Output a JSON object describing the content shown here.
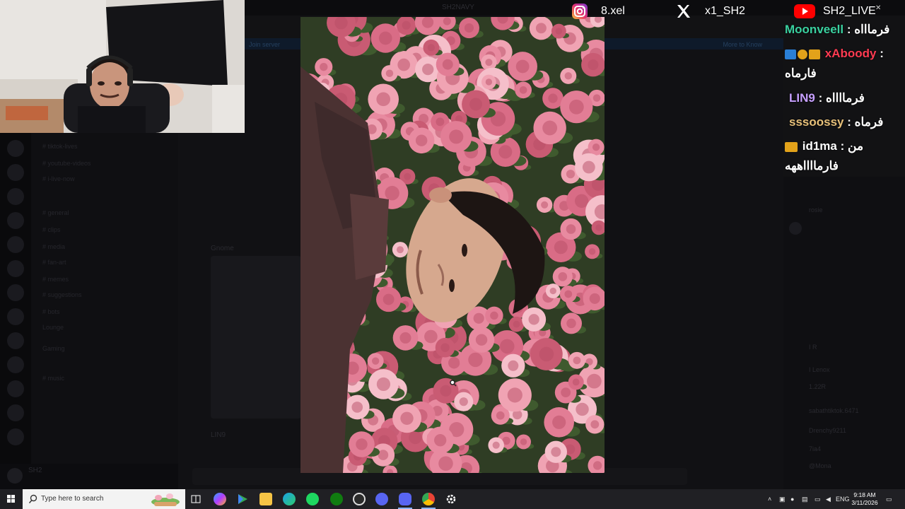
{
  "discord": {
    "window_title": "SH2NAVY",
    "banner_left": "Join server",
    "banner_right": "More to Know",
    "channels": [
      "# tiktok-lives",
      "# youtube-videos",
      "# i-live-now",
      "# general",
      "# clips",
      "# media",
      "# fan-art",
      "# memes",
      "# suggestions",
      "# bots",
      "Lounge",
      "Gaming",
      "# music"
    ],
    "chat_author": "Gnome",
    "chat_author_2": "LIN9",
    "members": [
      "rosie",
      "I R",
      "I Lenox",
      "1.22R",
      "sabathtiktok.6471",
      "Drenchy9211",
      "7ia4",
      "@Mona"
    ],
    "user_name": "SH2"
  },
  "social": [
    {
      "platform": "instagram",
      "icon": "instagram-icon",
      "handle": "8.xel"
    },
    {
      "platform": "x",
      "icon": "x-icon",
      "handle": "x1_SH2"
    },
    {
      "platform": "youtube",
      "icon": "youtube-icon",
      "handle": "SH2_LIVE"
    }
  ],
  "chat": [
    {
      "user": "Moonveell",
      "text": ": فرماااه",
      "color": "#3ad1a0",
      "badges": []
    },
    {
      "user": "xAboody",
      "text": ":",
      "continuation": "فارماه",
      "color": "#ff3b52",
      "badges": [
        "#2a7fd6",
        "#e2a21a",
        "#e2a21a"
      ]
    },
    {
      "user": "LIN9",
      "text": ": فرمااااه",
      "color": "#c7a0ff",
      "badges": []
    },
    {
      "user": "sssoossy",
      "text": ": فرماه",
      "color": "#e8c17a",
      "badges": []
    },
    {
      "user": "id1ma",
      "text": ": من",
      "continuation": "فارمااااههه",
      "color": "#ffffff",
      "badges": [
        "#e2a21a"
      ]
    }
  ],
  "taskbar": {
    "search_placeholder": "Type here to search",
    "language": "ENG",
    "time": "9:18 AM",
    "date": "3/11/2026",
    "apps": [
      "task-view-icon",
      "copilot-icon",
      "play-store-icon",
      "file-explorer-icon",
      "edge-icon",
      "spotify-icon",
      "xbox-icon",
      "obs-icon",
      "discord-ptb-icon",
      "discord-icon",
      "chrome-icon",
      "settings-icon"
    ]
  },
  "colors": {
    "taskbar": "#202024",
    "discord_bg": "#121214"
  }
}
